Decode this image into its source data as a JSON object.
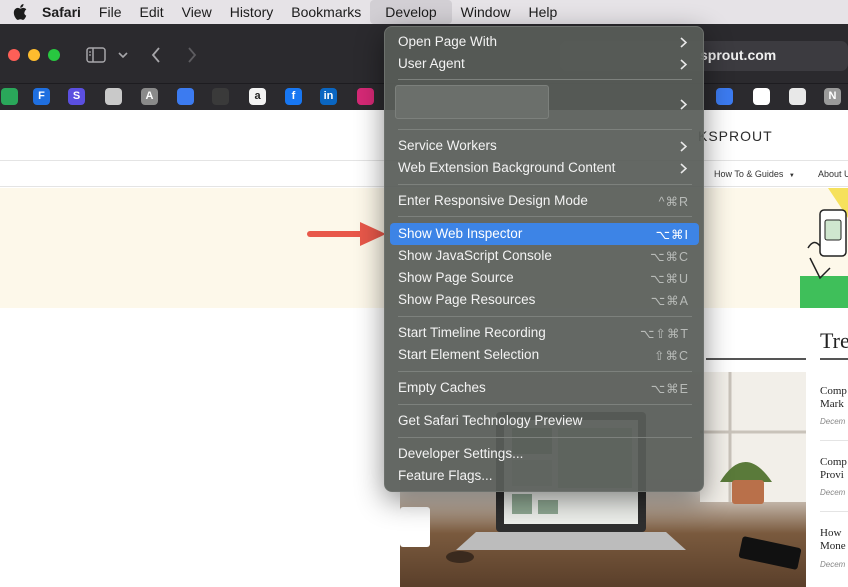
{
  "menubar": {
    "app_name": "Safari",
    "items": [
      "File",
      "Edit",
      "View",
      "History",
      "Bookmarks",
      "Develop",
      "Window",
      "Help"
    ],
    "active": "Develop"
  },
  "address_bar": {
    "url_fragment": "sprout.com"
  },
  "favorites": [
    {
      "icon": "plus-square-icon",
      "label": "",
      "color": "#2aa75a"
    },
    {
      "icon": "f-brand-icon",
      "label": "F",
      "color": "#1f6fe0"
    },
    {
      "icon": "s-brand-icon",
      "label": "S",
      "color": "#5b4fe0"
    },
    {
      "icon": "stack-icon",
      "label": "",
      "color": "#c9c9c9"
    },
    {
      "icon": "a-letter-icon",
      "label": "A",
      "color": "#8a8a8a"
    },
    {
      "icon": "doc-icon",
      "label": "",
      "color": "#3c7bf0"
    },
    {
      "icon": "waves-icon",
      "label": "",
      "color": "#3a3a3a"
    },
    {
      "icon": "amazon-icon",
      "label": "a",
      "color": "#f3f3f3"
    },
    {
      "icon": "facebook-icon",
      "label": "f",
      "color": "#1877f2"
    },
    {
      "icon": "linkedin-icon",
      "label": "in",
      "color": "#0a66c2"
    },
    {
      "icon": "instagram-icon",
      "label": "",
      "color": "#d62976"
    },
    {
      "icon": "doc-icon",
      "label": "",
      "color": "#3c7bf0"
    },
    {
      "icon": "monday-icon",
      "label": "",
      "color": "#ffffff"
    },
    {
      "icon": "owl-icon",
      "label": "",
      "color": "#e8e8e8"
    },
    {
      "icon": "n-letter-icon",
      "label": "N",
      "color": "#9a9a9a"
    }
  ],
  "page": {
    "site_name_fragment": "KSPROUT",
    "nav": [
      {
        "label": "How To & Guides",
        "has_dropdown": true
      },
      {
        "label": "About U",
        "has_dropdown": false
      }
    ],
    "sidebar_title": "Tre",
    "sidebar_posts": [
      {
        "line1": "Comp",
        "line2": "Mark",
        "date": "Decem"
      },
      {
        "line1": "Comp",
        "line2": "Provi",
        "date": "Decem"
      },
      {
        "line1": "How",
        "line2": "Mone",
        "date": "Decem"
      }
    ]
  },
  "develop_menu": {
    "groups": [
      [
        {
          "label": "Open Page With",
          "submenu": true
        },
        {
          "label": "User Agent",
          "submenu": true
        }
      ],
      [
        {
          "label": "",
          "submenu": true,
          "blank": true
        }
      ],
      [
        {
          "label": "Service Workers",
          "submenu": true
        },
        {
          "label": "Web Extension Background Content",
          "submenu": true
        }
      ],
      [
        {
          "label": "Enter Responsive Design Mode",
          "shortcut": "^⌘R"
        }
      ],
      [
        {
          "label": "Show Web Inspector",
          "shortcut": "⌥⌘I",
          "highlighted": true
        },
        {
          "label": "Show JavaScript Console",
          "shortcut": "⌥⌘C"
        },
        {
          "label": "Show Page Source",
          "shortcut": "⌥⌘U"
        },
        {
          "label": "Show Page Resources",
          "shortcut": "⌥⌘A"
        }
      ],
      [
        {
          "label": "Start Timeline Recording",
          "shortcut": "⌥⇧⌘T"
        },
        {
          "label": "Start Element Selection",
          "shortcut": "⇧⌘C"
        }
      ],
      [
        {
          "label": "Empty Caches",
          "shortcut": "⌥⌘E"
        }
      ],
      [
        {
          "label": "Get Safari Technology Preview"
        }
      ],
      [
        {
          "label": "Developer Settings..."
        },
        {
          "label": "Feature Flags..."
        }
      ]
    ]
  },
  "colors": {
    "highlight": "#3d84e6",
    "annotation_arrow": "#e8584a"
  }
}
